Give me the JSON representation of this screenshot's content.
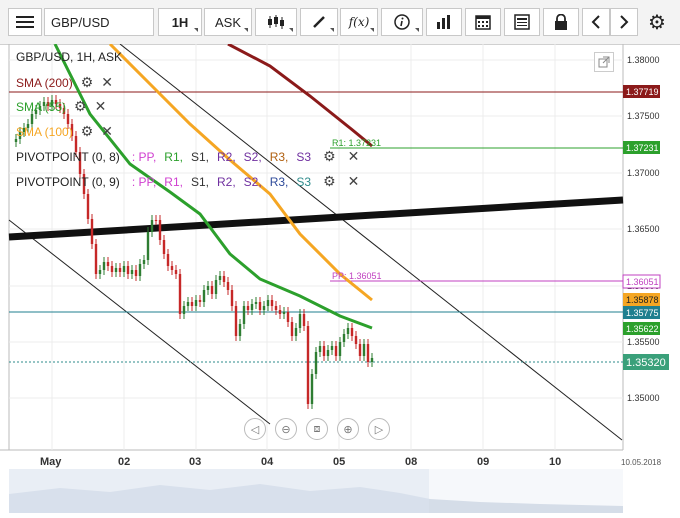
{
  "toolbar": {
    "symbol": "GBP/USD",
    "timeframe": "1H",
    "price_type": "ASK",
    "fx_label": "f(x)"
  },
  "chart_title": "GBP/USD, 1H, ASK",
  "indicators": [
    {
      "label": "SMA (200)",
      "color": "#8b1a1a"
    },
    {
      "label": "SMA (55)",
      "color": "#2ca02c"
    },
    {
      "label": "SMA (100)",
      "color": "#f5a623"
    }
  ],
  "pivots": [
    {
      "label": "PIVOTPOINT (0, 8)",
      "items": [
        ": PP,",
        "R1,",
        "S1,",
        "R2,",
        "S2,",
        "R3,",
        "S3"
      ]
    },
    {
      "label": "PIVOTPOINT (0, 9)",
      "items": [
        ": PP,",
        "R1,",
        "S1,",
        "R2,",
        "S2,",
        "R3,",
        "S3"
      ]
    }
  ],
  "pivot_colors": [
    "#d040d0",
    "#2ca02c",
    "#333333",
    "#7030a0",
    "#7030a0",
    "#b06010",
    "#7030a0"
  ],
  "pivot_colors_2": [
    "#d040d0",
    "#d040d0",
    "#333333",
    "#7030a0",
    "#7030a0",
    "#2e4a9a",
    "#2e8b8b"
  ],
  "price_labels": {
    "sma200": "1.37719",
    "r1": "1.37231",
    "pp": "1.36051",
    "sma100": "1.35878",
    "teal": "1.35775",
    "sma55": "1.35622",
    "current": "1.35320"
  },
  "line_tags": {
    "r1": "R1: 1.37231",
    "pp": "PP: 1.36051"
  },
  "y_ticks": [
    "1.38000",
    "1.37500",
    "1.37000",
    "1.36500",
    "1.36000",
    "1.35500",
    "1.35000"
  ],
  "x_ticks": [
    "May",
    "02",
    "03",
    "04",
    "05",
    "08",
    "09",
    "10"
  ],
  "x_corner_date": "10.05.2018",
  "chart_data": {
    "type": "line",
    "ylim": [
      1.3455,
      1.3845
    ],
    "x": [
      "May",
      "02",
      "03",
      "04",
      "05",
      "08",
      "09",
      "10"
    ],
    "series": [
      {
        "name": "SMA (200)",
        "values": [
          1.3842,
          1.3805,
          1.3772
        ]
      },
      {
        "name": "SMA (55)",
        "values": [
          1.3802,
          1.366,
          1.358,
          1.3562
        ]
      },
      {
        "name": "SMA (100)",
        "values": [
          1.382,
          1.372,
          1.364,
          1.3588
        ]
      }
    ]
  }
}
